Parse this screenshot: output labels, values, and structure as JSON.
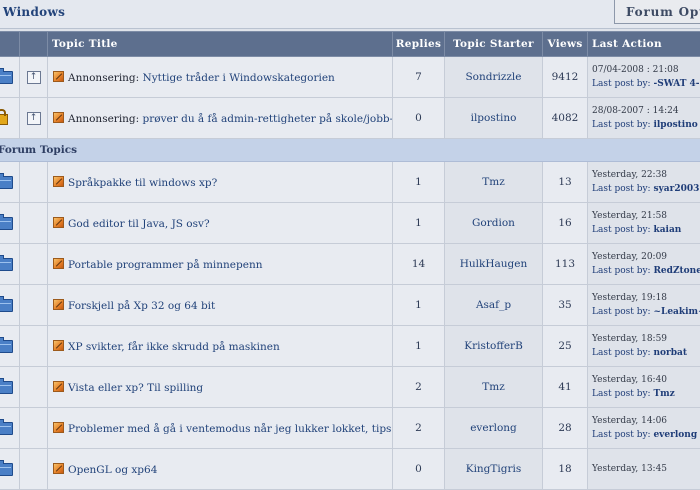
{
  "forum": {
    "title": "Windows",
    "options_label": "Forum Options"
  },
  "columns": {
    "title": "Topic Title",
    "replies": "Replies",
    "starter": "Topic Starter",
    "views": "Views",
    "last_action": "Last Action"
  },
  "last_post_prefix": "Last post by: ",
  "announcements": [
    {
      "prefix": "Annonsering: ",
      "title": "Nyttige tråder i Windowskategorien",
      "replies": "7",
      "starter": "Sondrizzle",
      "views": "9412",
      "last_time": "07/04-2008 : 21:08",
      "last_by": "-SWAT 4-",
      "icon": "folder-icon"
    },
    {
      "prefix": "Annonsering: ",
      "title": "prøver du å få admin-rettigheter på skole/jobb-pc?",
      "replies": "0",
      "starter": "ilpostino",
      "views": "4082",
      "last_time": "28/08-2007 : 14:24",
      "last_by": "ilpostino",
      "icon": "lock-icon"
    }
  ],
  "section_label": "Forum Topics",
  "topics": [
    {
      "title": "Språkpakke til windows xp?",
      "replies": "1",
      "starter": "Tmz",
      "views": "13",
      "last_time": "Yesterday, 22:38",
      "last_by": "syar2003"
    },
    {
      "title": "God editor til Java, JS osv?",
      "replies": "1",
      "starter": "Gordion",
      "views": "16",
      "last_time": "Yesterday, 21:58",
      "last_by": "kaian"
    },
    {
      "title": "Portable programmer på minnepenn",
      "replies": "14",
      "starter": "HulkHaugen",
      "views": "113",
      "last_time": "Yesterday, 20:09",
      "last_by": "RedZtone"
    },
    {
      "title": "Forskjell på Xp 32 og 64 bit",
      "replies": "1",
      "starter": "Asaf_p",
      "views": "35",
      "last_time": "Yesterday, 19:18",
      "last_by": "~Leakim~"
    },
    {
      "title": "XP svikter, får ikke skrudd på maskinen",
      "replies": "1",
      "starter": "KristofferB",
      "views": "25",
      "last_time": "Yesterday, 18:59",
      "last_by": "norbat"
    },
    {
      "title": "Vista eller xp? Til spilling",
      "replies": "2",
      "starter": "Tmz",
      "views": "41",
      "last_time": "Yesterday, 16:40",
      "last_by": "Tmz"
    },
    {
      "title": "Problemer med å gå i ventemodus når jeg lukker lokket, tips?",
      "replies": "2",
      "starter": "everlong",
      "views": "28",
      "last_time": "Yesterday, 14:06",
      "last_by": "everlong"
    },
    {
      "title": "OpenGL og xp64",
      "replies": "0",
      "starter": "KingTigris",
      "views": "18",
      "last_time": "Yesterday, 13:45",
      "last_by": ""
    }
  ]
}
